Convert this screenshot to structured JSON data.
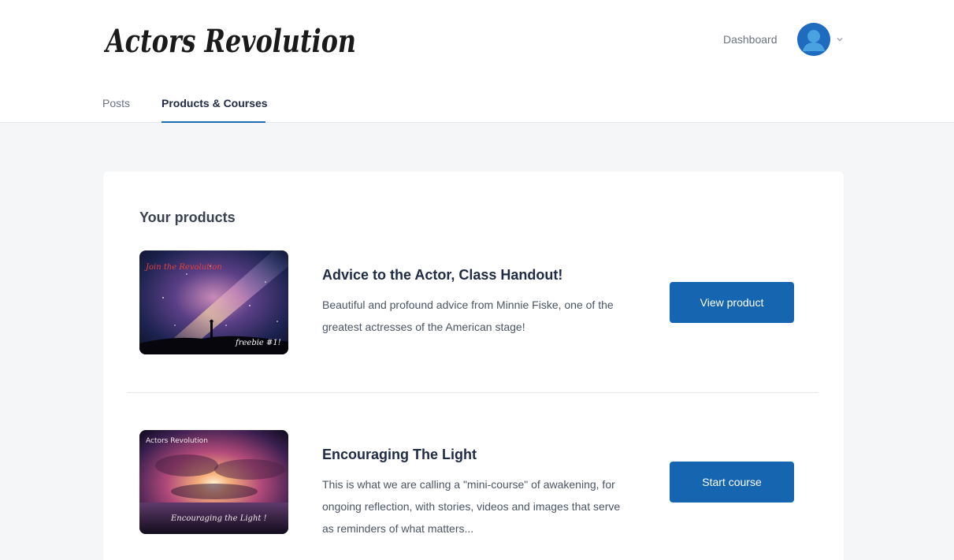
{
  "header": {
    "logo_text": "Actors Revolution",
    "dashboard_label": "Dashboard",
    "avatar_icon": "user-avatar-icon",
    "chevron_icon": "chevron-down-icon"
  },
  "tabs": [
    {
      "label": "Posts",
      "active": false
    },
    {
      "label": "Products & Courses",
      "active": true
    }
  ],
  "products_section": {
    "title": "Your products",
    "items": [
      {
        "title": "Advice to the Actor, Class Handout!",
        "description": "Beautiful and profound advice from Minnie Fiske, one of the greatest actresses of the American stage!",
        "button_label": "View product",
        "thumb_caption_top": "Join the Revolution",
        "thumb_caption_bottom": "freebie #1!"
      },
      {
        "title": "Encouraging The Light",
        "description": "This is what we are calling a \"mini-course\" of awakening, for ongoing reflection, with stories, videos and images that serve as reminders of what matters...",
        "button_label": "Start course",
        "thumb_caption_top": "Actors Revolution",
        "thumb_caption_bottom": "Encouraging the Light !"
      }
    ]
  },
  "colors": {
    "accent": "#1565b0",
    "tab_active": "#1f6bb5",
    "page_bg": "#f5f6f8"
  }
}
